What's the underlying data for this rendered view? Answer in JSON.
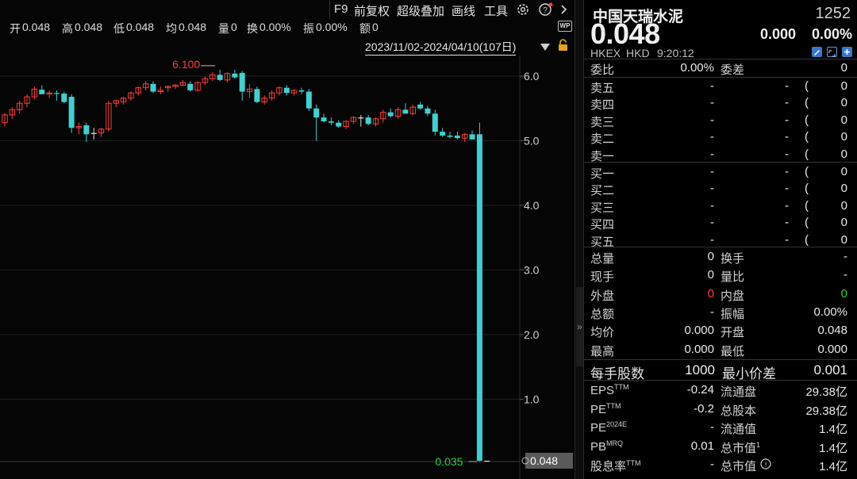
{
  "toolbar": {
    "f9": "F9",
    "adjust": "前复权",
    "overlay": "超级叠加",
    "draw": "画线",
    "tools": "工具"
  },
  "stats": {
    "open_label": "开",
    "open": "0.048",
    "high_label": "高",
    "high": "0.048",
    "low_label": "低",
    "low": "0.048",
    "avg_label": "均",
    "avg": "0.048",
    "vol_label": "量",
    "vol": "0",
    "turnover_label": "换",
    "turnover": "0.00%",
    "amplitude_label": "振",
    "amplitude": "0.00%",
    "amount_label": "额",
    "amount": "0"
  },
  "range": "2023/11/02-2024/04/10(107日)",
  "wp_badge": "WP",
  "colors": {
    "up": "#ff3b3b",
    "down": "#3fd0d0",
    "down_bar": "#3ecfcf",
    "accent_red": "#ff3b3b",
    "accent_green": "#27d33f"
  },
  "chart_data": {
    "type": "candlestick",
    "y_ticks": [
      "6.0",
      "5.0",
      "4.0",
      "3.0",
      "2.0",
      "1.0"
    ],
    "y_tick_values": [
      6,
      5,
      4,
      3,
      2,
      1
    ],
    "ylim": [
      0,
      6.2
    ],
    "high_marker": {
      "label": "6.100",
      "value": 6.1
    },
    "low_marker": {
      "label": "0.035",
      "value": 0.035
    },
    "last_price_tag": "0.048",
    "candles": [
      {
        "o": 5.28,
        "h": 5.43,
        "l": 5.22,
        "c": 5.4
      },
      {
        "o": 5.4,
        "h": 5.52,
        "l": 5.34,
        "c": 5.48
      },
      {
        "o": 5.48,
        "h": 5.62,
        "l": 5.42,
        "c": 5.58
      },
      {
        "o": 5.58,
        "h": 5.72,
        "l": 5.52,
        "c": 5.68
      },
      {
        "o": 5.68,
        "h": 5.84,
        "l": 5.64,
        "c": 5.8
      },
      {
        "o": 5.79,
        "h": 5.86,
        "l": 5.74,
        "c": 5.72
      },
      {
        "o": 5.73,
        "h": 5.78,
        "l": 5.66,
        "c": 5.74
      },
      {
        "o": 5.74,
        "h": 5.78,
        "l": 5.62,
        "c": 5.73
      },
      {
        "o": 5.73,
        "h": 5.76,
        "l": 5.58,
        "c": 5.6
      },
      {
        "o": 5.68,
        "h": 5.72,
        "l": 5.12,
        "c": 5.2
      },
      {
        "o": 5.2,
        "h": 5.28,
        "l": 5.1,
        "c": 5.22
      },
      {
        "o": 5.24,
        "h": 5.28,
        "l": 4.98,
        "c": 5.1
      },
      {
        "o": 5.12,
        "h": 5.2,
        "l": 5.02,
        "c": 5.12
      },
      {
        "o": 5.12,
        "h": 5.2,
        "l": 5.06,
        "c": 5.18
      },
      {
        "o": 5.18,
        "h": 5.62,
        "l": 5.14,
        "c": 5.58
      },
      {
        "o": 5.58,
        "h": 5.64,
        "l": 5.52,
        "c": 5.62
      },
      {
        "o": 5.6,
        "h": 5.68,
        "l": 5.56,
        "c": 5.66
      },
      {
        "o": 5.66,
        "h": 5.76,
        "l": 5.62,
        "c": 5.74
      },
      {
        "o": 5.74,
        "h": 5.84,
        "l": 5.7,
        "c": 5.82
      },
      {
        "o": 5.82,
        "h": 5.92,
        "l": 5.78,
        "c": 5.88
      },
      {
        "o": 5.88,
        "h": 5.92,
        "l": 5.74,
        "c": 5.76
      },
      {
        "o": 5.76,
        "h": 5.84,
        "l": 5.72,
        "c": 5.78
      },
      {
        "o": 5.82,
        "h": 5.86,
        "l": 5.76,
        "c": 5.84
      },
      {
        "o": 5.84,
        "h": 5.88,
        "l": 5.8,
        "c": 5.86
      },
      {
        "o": 5.86,
        "h": 5.94,
        "l": 5.84,
        "c": 5.9
      },
      {
        "o": 5.88,
        "h": 5.92,
        "l": 5.76,
        "c": 5.78
      },
      {
        "o": 5.78,
        "h": 5.92,
        "l": 5.76,
        "c": 5.9
      },
      {
        "o": 5.9,
        "h": 6.0,
        "l": 5.86,
        "c": 5.96
      },
      {
        "o": 5.96,
        "h": 6.06,
        "l": 5.92,
        "c": 6.02
      },
      {
        "o": 6.02,
        "h": 6.1,
        "l": 5.92,
        "c": 5.94
      },
      {
        "o": 5.94,
        "h": 6.06,
        "l": 5.9,
        "c": 6.04
      },
      {
        "o": 6.04,
        "h": 6.1,
        "l": 5.96,
        "c": 5.98
      },
      {
        "o": 6.05,
        "h": 6.08,
        "l": 5.62,
        "c": 5.76
      },
      {
        "o": 5.76,
        "h": 5.88,
        "l": 5.66,
        "c": 5.8
      },
      {
        "o": 5.8,
        "h": 5.84,
        "l": 5.58,
        "c": 5.6
      },
      {
        "o": 5.6,
        "h": 5.7,
        "l": 5.56,
        "c": 5.66
      },
      {
        "o": 5.66,
        "h": 5.78,
        "l": 5.62,
        "c": 5.74
      },
      {
        "o": 5.74,
        "h": 5.84,
        "l": 5.7,
        "c": 5.82
      },
      {
        "o": 5.82,
        "h": 5.86,
        "l": 5.7,
        "c": 5.74
      },
      {
        "o": 5.74,
        "h": 5.8,
        "l": 5.7,
        "c": 5.78
      },
      {
        "o": 5.78,
        "h": 5.82,
        "l": 5.72,
        "c": 5.76
      },
      {
        "o": 5.76,
        "h": 5.8,
        "l": 5.46,
        "c": 5.5
      },
      {
        "o": 5.5,
        "h": 5.56,
        "l": 5.0,
        "c": 5.36
      },
      {
        "o": 5.36,
        "h": 5.42,
        "l": 5.28,
        "c": 5.3
      },
      {
        "o": 5.3,
        "h": 5.36,
        "l": 5.24,
        "c": 5.28
      },
      {
        "o": 5.28,
        "h": 5.32,
        "l": 5.2,
        "c": 5.22
      },
      {
        "o": 5.22,
        "h": 5.32,
        "l": 5.18,
        "c": 5.3
      },
      {
        "o": 5.3,
        "h": 5.38,
        "l": 5.26,
        "c": 5.36
      },
      {
        "o": 5.36,
        "h": 5.4,
        "l": 5.22,
        "c": 5.36
      },
      {
        "o": 5.36,
        "h": 5.4,
        "l": 5.24,
        "c": 5.26
      },
      {
        "o": 5.26,
        "h": 5.36,
        "l": 5.22,
        "c": 5.34
      },
      {
        "o": 5.34,
        "h": 5.48,
        "l": 5.28,
        "c": 5.44
      },
      {
        "o": 5.44,
        "h": 5.5,
        "l": 5.36,
        "c": 5.38
      },
      {
        "o": 5.38,
        "h": 5.52,
        "l": 5.34,
        "c": 5.48
      },
      {
        "o": 5.48,
        "h": 5.58,
        "l": 5.42,
        "c": 5.42
      },
      {
        "o": 5.42,
        "h": 5.56,
        "l": 5.4,
        "c": 5.52
      },
      {
        "o": 5.56,
        "h": 5.6,
        "l": 5.48,
        "c": 5.5
      },
      {
        "o": 5.5,
        "h": 5.54,
        "l": 5.38,
        "c": 5.42
      },
      {
        "o": 5.42,
        "h": 5.48,
        "l": 5.08,
        "c": 5.14
      },
      {
        "o": 5.14,
        "h": 5.2,
        "l": 5.06,
        "c": 5.08
      },
      {
        "o": 5.08,
        "h": 5.14,
        "l": 5.04,
        "c": 5.06
      },
      {
        "o": 5.08,
        "h": 5.14,
        "l": 5.02,
        "c": 5.04
      },
      {
        "o": 5.04,
        "h": 5.12,
        "l": 4.98,
        "c": 5.1
      },
      {
        "o": 5.1,
        "h": 5.16,
        "l": 5.02,
        "c": 5.02
      },
      {
        "o": 5.1,
        "h": 5.28,
        "l": 0.035,
        "c": 0.048
      },
      {
        "o": 0.048,
        "h": 0.048,
        "l": 0.048,
        "c": 0.048
      }
    ]
  },
  "quote": {
    "name": "中国天瑞水泥",
    "code": "1252",
    "price": "0.048",
    "change": "0.000",
    "change_pct": "0.00%",
    "market": "HKEX",
    "currency": "HKD",
    "time": "9:20:12",
    "weibi_label": "委比",
    "weibi": "0.00%",
    "weicha_label": "委差",
    "weicha": "0",
    "asks": [
      {
        "label": "卖五",
        "price": "-",
        "vol": "-",
        "cnt": "0"
      },
      {
        "label": "卖四",
        "price": "-",
        "vol": "-",
        "cnt": "0"
      },
      {
        "label": "卖三",
        "price": "-",
        "vol": "-",
        "cnt": "0"
      },
      {
        "label": "卖二",
        "price": "-",
        "vol": "-",
        "cnt": "0"
      },
      {
        "label": "卖一",
        "price": "-",
        "vol": "-",
        "cnt": "0"
      }
    ],
    "bids": [
      {
        "label": "买一",
        "price": "-",
        "vol": "-",
        "cnt": "0"
      },
      {
        "label": "买二",
        "price": "-",
        "vol": "-",
        "cnt": "0"
      },
      {
        "label": "买三",
        "price": "-",
        "vol": "-",
        "cnt": "0"
      },
      {
        "label": "买四",
        "price": "-",
        "vol": "-",
        "cnt": "0"
      },
      {
        "label": "买五",
        "price": "-",
        "vol": "-",
        "cnt": "0"
      }
    ],
    "stats": [
      {
        "l1": "总量",
        "v1": "0",
        "l2": "换手",
        "v2": "-"
      },
      {
        "l1": "现手",
        "v1": "0",
        "l2": "量比",
        "v2": "-"
      },
      {
        "l1": "外盘",
        "v1": "0",
        "l2": "内盘",
        "v2": "0"
      },
      {
        "l1": "总额",
        "v1": "-",
        "l2": "振幅",
        "v2": "0.00%"
      },
      {
        "l1": "均价",
        "v1": "0.000",
        "l2": "开盘",
        "v2": "0.048"
      },
      {
        "l1": "最高",
        "v1": "0.000",
        "l2": "最低",
        "v2": "0.000"
      }
    ],
    "lot_label": "每手股数",
    "lot": "1000",
    "tick_label": "最小价差",
    "tick": "0.001",
    "fund": [
      {
        "l1": "EPS",
        "s1": "TTM",
        "v1": "-0.24",
        "l2": "流通盘",
        "s2": "",
        "v2": "29.38亿"
      },
      {
        "l1": "PE",
        "s1": "TTM",
        "v1": "-0.2",
        "l2": "总股本",
        "s2": "",
        "v2": "29.38亿"
      },
      {
        "l1": "PE",
        "s1": "2024E",
        "v1": "-",
        "l2": "流通值",
        "s2": "",
        "v2": "1.4亿"
      },
      {
        "l1": "PB",
        "s1": "MRQ",
        "v1": "0.01",
        "l2": "总市值",
        "s2": "1",
        "v2": "1.4亿"
      },
      {
        "l1": "股息率",
        "s1": "TTM",
        "v1": "-",
        "l2": "总市值",
        "s2": "",
        "v2": "1.4亿"
      }
    ]
  }
}
